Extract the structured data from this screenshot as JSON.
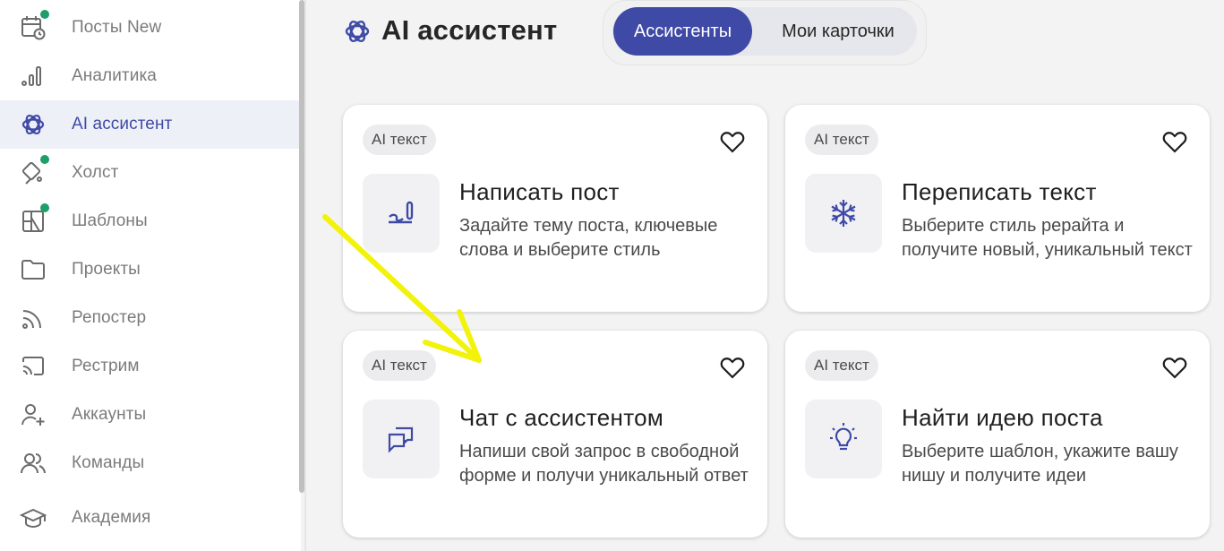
{
  "sidebar": {
    "items": [
      {
        "label": "Посты New",
        "icon": "calendar-clock-icon",
        "dot": true
      },
      {
        "label": "Аналитика",
        "icon": "bar-chart-icon",
        "dot": false
      },
      {
        "label": "AI ассистент",
        "icon": "openai-logo-icon",
        "dot": false,
        "active": true
      },
      {
        "label": "Холст",
        "icon": "canvas-pen-icon",
        "dot": true
      },
      {
        "label": "Шаблоны",
        "icon": "template-layout-icon",
        "dot": true
      },
      {
        "label": "Проекты",
        "icon": "folder-icon",
        "dot": false
      },
      {
        "label": "Репостер",
        "icon": "rss-icon",
        "dot": false
      },
      {
        "label": "Рестрим",
        "icon": "cast-icon",
        "dot": false
      },
      {
        "label": "Аккаунты",
        "icon": "user-plus-icon",
        "dot": false
      },
      {
        "label": "Команды",
        "icon": "users-icon",
        "dot": false
      },
      {
        "label": "Академия",
        "icon": "graduation-cap-icon",
        "dot": false
      }
    ]
  },
  "header": {
    "title": "AI ассистент",
    "tabs": [
      {
        "label": "Ассистенты",
        "active": true
      },
      {
        "label": "Мои карточки",
        "active": false
      }
    ]
  },
  "cards": [
    {
      "badge": "AI текст",
      "icon": "pen-write-icon",
      "title": "Написать пост",
      "description": "Задайте тему поста, ключевые слова и выберите стиль"
    },
    {
      "badge": "AI текст",
      "icon": "snowflake-icon",
      "title": "Переписать текст",
      "description": "Выберите стиль рерайта и получите новый, уникальный текст"
    },
    {
      "badge": "AI текст",
      "icon": "chat-bubbles-icon",
      "title": "Чат с ассистентом",
      "description": "Напиши свой запрос в свободной форме и получи уникальный ответ"
    },
    {
      "badge": "AI текст",
      "icon": "lightbulb-icon",
      "title": "Найти идею поста",
      "description": "Выберите шаблон, укажите вашу нишу и получите идеи"
    }
  ],
  "colors": {
    "accent": "#3f4aa6",
    "active_bg": "#eef0f8",
    "new_dot": "#1e9e6b",
    "annotation_arrow": "#f2f20a"
  }
}
